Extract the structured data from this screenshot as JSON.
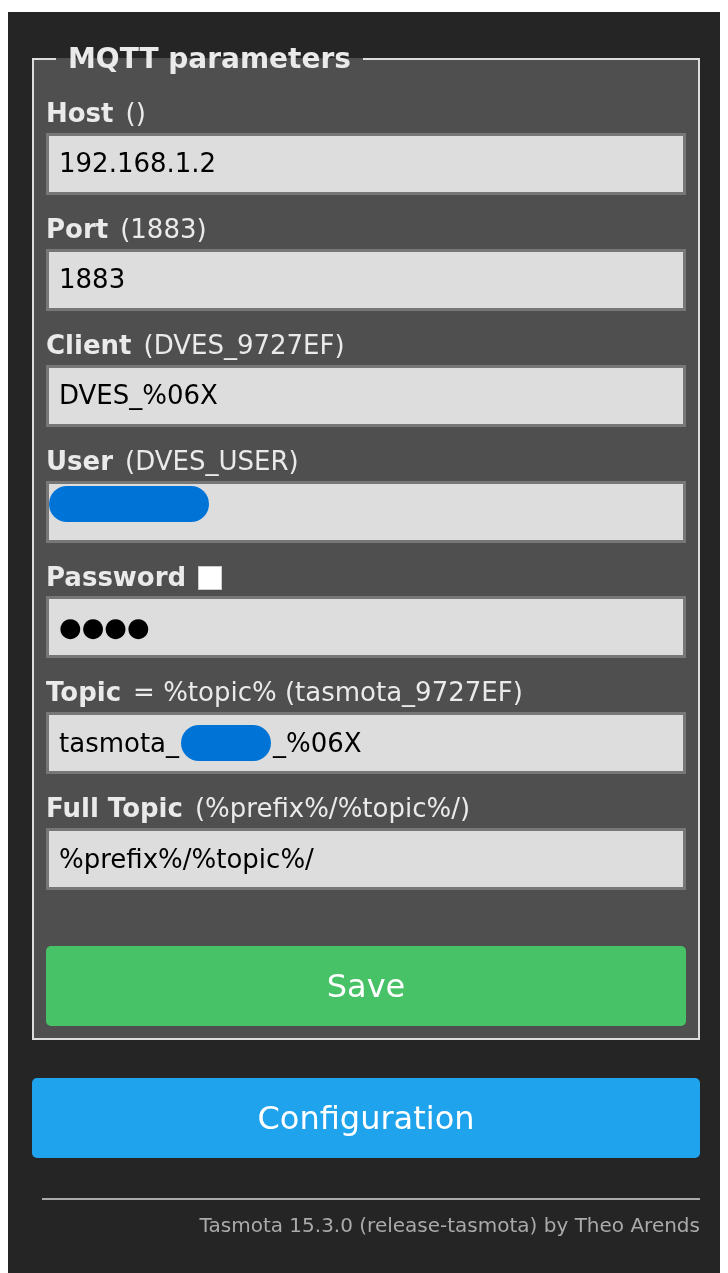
{
  "section": {
    "legend": "MQTT parameters"
  },
  "fields": [
    {
      "kind": "text",
      "label": "Host",
      "hint": "()",
      "value": "192.168.1.2"
    },
    {
      "kind": "text",
      "label": "Port",
      "hint": "(1883)",
      "value": "1883"
    },
    {
      "kind": "text",
      "label": "Client",
      "hint": "(DVES_9727EF)",
      "value": "DVES_%06X"
    },
    {
      "kind": "text",
      "label": "User",
      "hint": "(DVES_USER)",
      "redacted": true
    },
    {
      "kind": "password",
      "label": "Password",
      "show_password": false,
      "value": "●●●●"
    },
    {
      "kind": "text",
      "label": "Topic",
      "hint": "= %topic% (tasmota_9727EF)",
      "value": "tasmota_",
      "value_after_redaction": "_%06X",
      "redacted": true
    },
    {
      "kind": "text",
      "label": "Full Topic",
      "hint": "(%prefix%/%topic%/)",
      "value": "%prefix%/%topic%/"
    }
  ],
  "save_button": "Save",
  "configuration_button": "Configuration",
  "footer": "Tasmota 15.3.0 (release-tasmota) by Theo Arends"
}
